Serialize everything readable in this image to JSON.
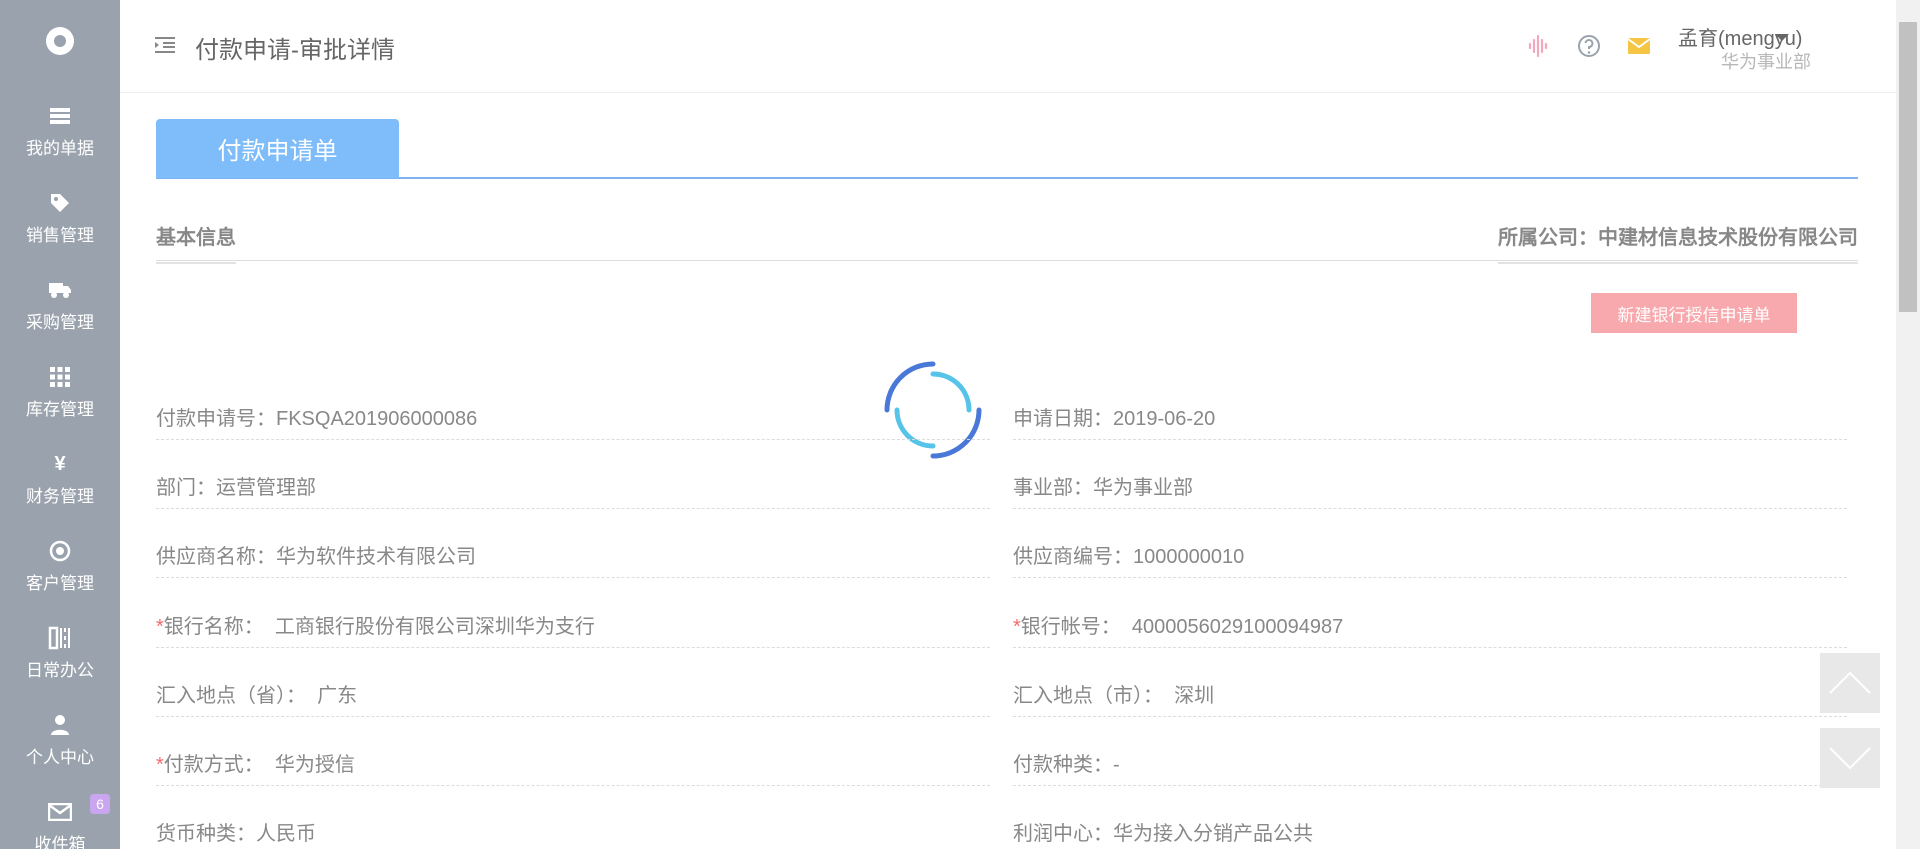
{
  "sidebar": {
    "logo_icon": "settings-logo-icon",
    "items": [
      {
        "label": "我的单据",
        "icon": "documents-icon"
      },
      {
        "label": "销售管理",
        "icon": "tag-icon"
      },
      {
        "label": "采购管理",
        "icon": "truck-icon"
      },
      {
        "label": "库存管理",
        "icon": "grid-icon"
      },
      {
        "label": "财务管理",
        "icon": "yen-icon"
      },
      {
        "label": "客户管理",
        "icon": "target-icon"
      },
      {
        "label": "日常办公",
        "icon": "office-icon"
      },
      {
        "label": "个人中心",
        "icon": "user-icon"
      },
      {
        "label": "收件箱",
        "icon": "mail-icon",
        "badge": "6"
      }
    ]
  },
  "header": {
    "title": "付款申请-审批详情",
    "user_name": "孟育(mengyu)",
    "user_dept": "华为事业部",
    "icons": [
      "audio-icon",
      "help-icon",
      "mail-icon"
    ]
  },
  "tabs": [
    {
      "label": "付款申请单"
    }
  ],
  "section": {
    "title": "基本信息",
    "company": "所属公司：中建材信息技术股份有限公司"
  },
  "actions": {
    "new_credit": "新建银行授信申请单"
  },
  "fields": {
    "left": [
      {
        "label": "付款申请号：",
        "value": "FKSQA201906000086",
        "required": false
      },
      {
        "label": "部门：",
        "value": "运营管理部",
        "required": false
      },
      {
        "label": "供应商名称：",
        "value": "华为软件技术有限公司",
        "required": false
      },
      {
        "label": "银行名称：",
        "value": "工商银行股份有限公司深圳华为支行",
        "required": true
      },
      {
        "label": "汇入地点（省）：",
        "value": "广东",
        "required": false
      },
      {
        "label": "付款方式：",
        "value": "华为授信",
        "required": true
      },
      {
        "label": "货币种类：",
        "value": "人民币",
        "required": false
      }
    ],
    "right": [
      {
        "label": "申请日期：",
        "value": "2019-06-20",
        "required": false
      },
      {
        "label": "事业部：",
        "value": "华为事业部",
        "required": false
      },
      {
        "label": "供应商编号：",
        "value": "1000000010",
        "required": false
      },
      {
        "label": "银行帐号：",
        "value": "4000056029100094987",
        "required": true
      },
      {
        "label": "汇入地点（市）：",
        "value": "深圳",
        "required": false
      },
      {
        "label": "付款种类：",
        "value": "-",
        "required": false
      },
      {
        "label": "利润中心：",
        "value": "华为接入分销产品公共",
        "required": false
      }
    ]
  },
  "colors": {
    "sidebar": "#9aa3ad",
    "tab_active": "#7ebcfa",
    "accent_line": "#7fb2f0",
    "button_pink": "#f8a9ad",
    "required": "#f26b6b",
    "badge": "#c9a6ef"
  }
}
